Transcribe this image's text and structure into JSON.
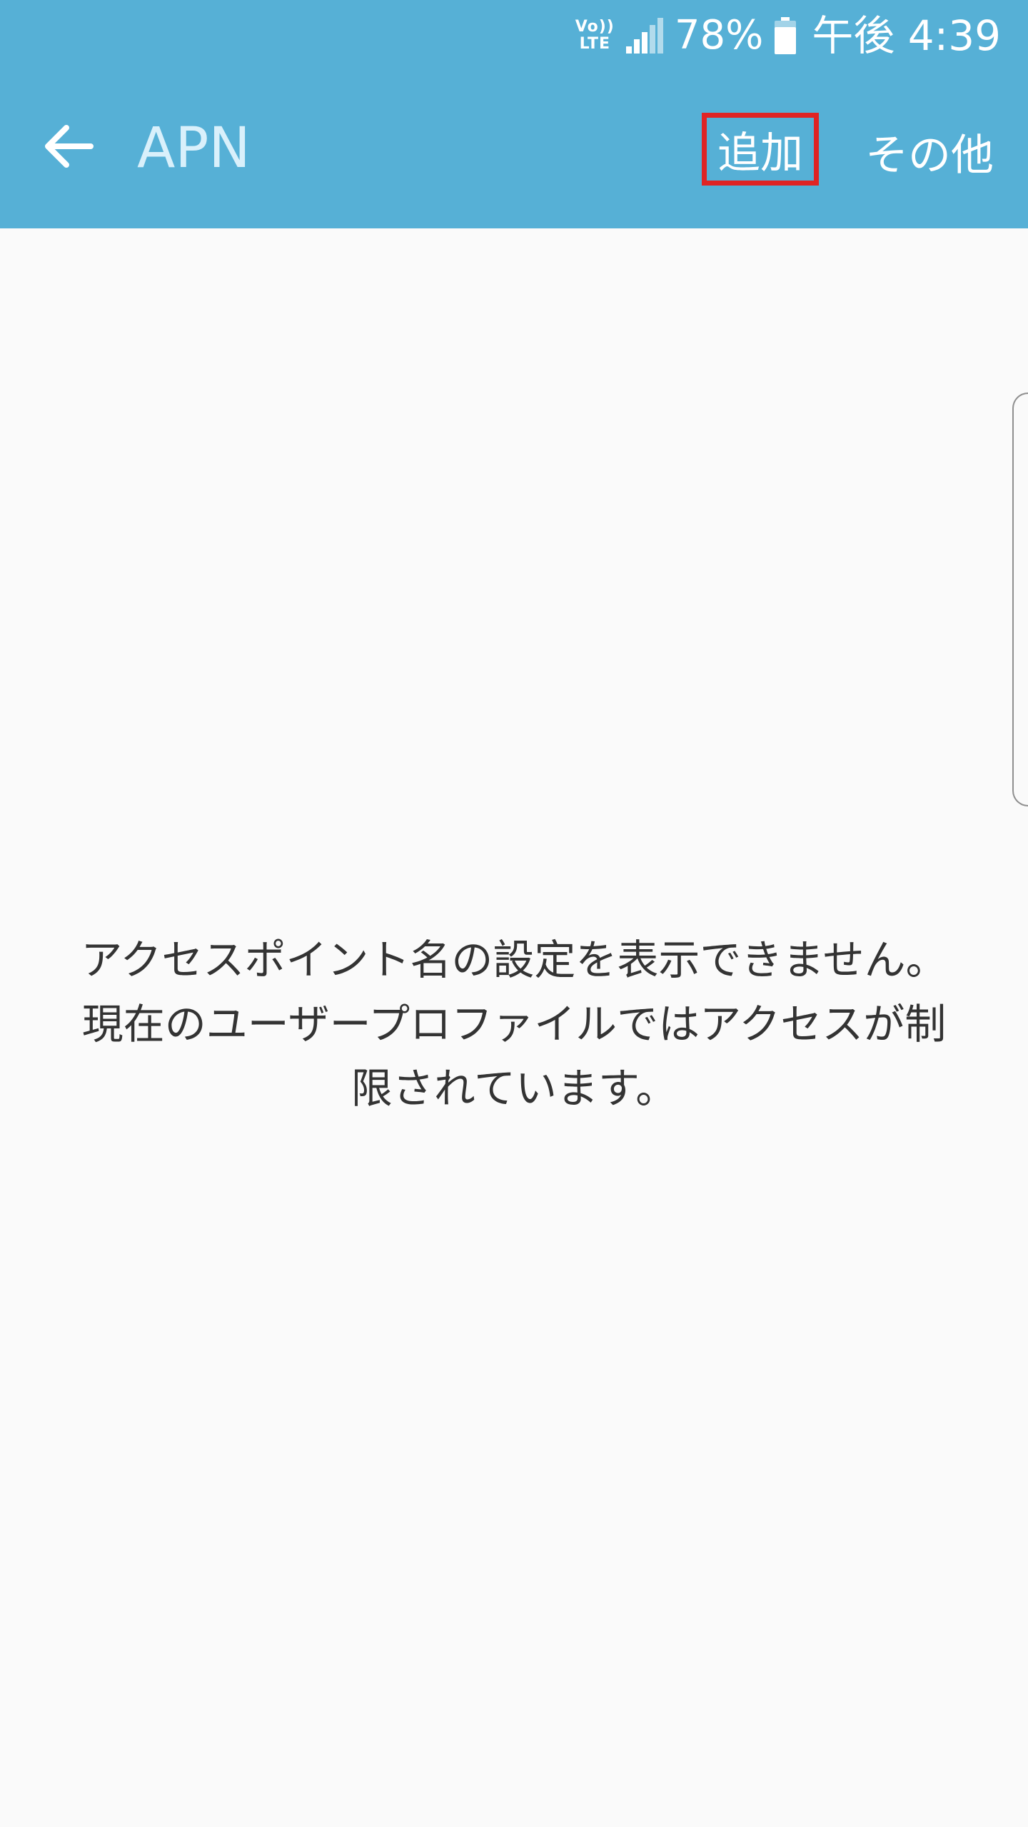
{
  "status_bar": {
    "volte_top": "Vo))",
    "volte_bottom": "LTE",
    "signal_icon": "signal-icon",
    "battery_percent": "78%",
    "battery_icon": "battery-icon",
    "time": "午後 4:39"
  },
  "toolbar": {
    "back_icon": "arrow-left-icon",
    "title": "APN",
    "add_label": "追加",
    "more_label": "その他"
  },
  "message": {
    "lines": [
      "アクセスポイント名の設定を表示できません。",
      "現在のユーザープロファイルではアクセスが制",
      "限されています。"
    ]
  },
  "colors": {
    "header_bg": "#56b0d6",
    "page_bg": "#fafafa",
    "highlight_border": "#e02424",
    "text": "#333333"
  }
}
